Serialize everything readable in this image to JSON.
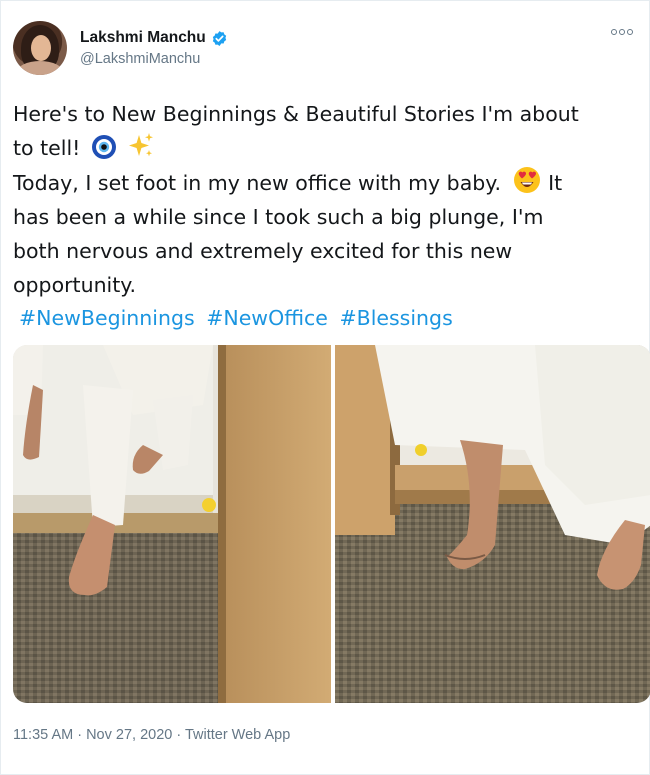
{
  "tweet": {
    "author": {
      "name": "Lakshmi Manchu",
      "handle": "@LakshmiManchu"
    },
    "lines": [
      "Here's to New Beginnings & Beautiful Stories I'm about",
      "to tell!",
      "Today, I set foot in my new office with my baby.",
      "It",
      "has been a while since I took such a big plunge, I'm",
      "both nervous and extremely excited for this new",
      "opportunity."
    ],
    "emojis": [
      "nazar-amulet-emoji",
      "sparkles-emoji",
      "heart-eyes-emoji"
    ],
    "hashtags": [
      "#NewBeginnings",
      "#NewOffice",
      "#Blessings"
    ],
    "timestamp": "11:35 AM · Nov 27, 2020 · Twitter Web App"
  },
  "colors": {
    "link": "#1b95e0",
    "text": "#14171a",
    "muted": "#657786",
    "verified": "#1da1f2"
  }
}
